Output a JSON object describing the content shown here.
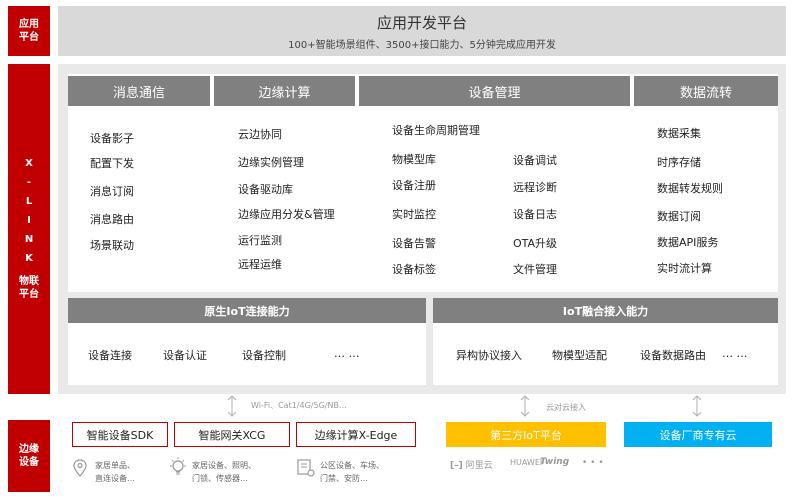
{
  "side": {
    "app_line1": "应用",
    "app_line2": "平台",
    "xlink_letters": [
      "X",
      "-",
      "L",
      "I",
      "N",
      "K"
    ],
    "xlink_line1": "物联",
    "xlink_line2": "平台",
    "edge_line1": "边缘",
    "edge_line2": "设备"
  },
  "platform": {
    "title": "应用开发平台",
    "subtitle": "100+智能场景组件、3500+接口能力、5分钟完成应用开发"
  },
  "modules": {
    "messaging": {
      "title": "消息通信",
      "items": [
        "设备影子",
        "配置下发",
        "消息订阅",
        "消息路由",
        "场景联动"
      ]
    },
    "edge": {
      "title": "边缘计算",
      "items": [
        "云边协同",
        "边缘实例管理",
        "设备驱动库",
        "边缘应用分发&管理",
        "运行监测",
        "远程运维"
      ]
    },
    "device": {
      "title": "设备管理",
      "top": "设备生命周期管理",
      "left": [
        "物模型库",
        "设备注册",
        "实时监控",
        "设备告警",
        "设备标签"
      ],
      "right": [
        "设备调试",
        "远程诊断",
        "设备日志",
        "OTA升级",
        "文件管理"
      ]
    },
    "data": {
      "title": "数据流转",
      "items": [
        "数据采集",
        "时序存储",
        "数据转发规则",
        "数据订阅",
        "数据API服务",
        "实时流计算"
      ]
    }
  },
  "native": {
    "title": "原生IoT连接能力",
    "items": [
      "设备连接",
      "设备认证",
      "设备控制",
      "… …"
    ]
  },
  "fusion": {
    "title": "IoT融合接入能力",
    "items": [
      "异构协议接入",
      "物模型适配",
      "设备数据路由",
      "… …"
    ]
  },
  "connectors": {
    "left": "Wi-Fi、Cat1/4G/5G/NB…",
    "right": "云对云接入"
  },
  "edge_boxes": {
    "sdk": "智能设备SDK",
    "gateway": "智能网关XCG",
    "edge": "边缘计算X-Edge",
    "third_party": "第三方IoT平台",
    "vendor": "设备厂商专有云"
  },
  "devices": {
    "d1_line1": "家居单品、",
    "d1_line2": "直连设备…",
    "d2_line1": "家居设备、照明、",
    "d2_line2": "门锁、传感器…",
    "d3_line1": "公区设备、车场、",
    "d3_line2": "门禁、安防…"
  },
  "logos": {
    "aliyun": "阿里云",
    "huawei": "HUAWEI",
    "twing": "Twing",
    "more": "• • •"
  },
  "colors": {
    "red": "#c00000",
    "header_gray": "#808080",
    "yellow": "#ffc000",
    "blue": "#00b0f0"
  }
}
